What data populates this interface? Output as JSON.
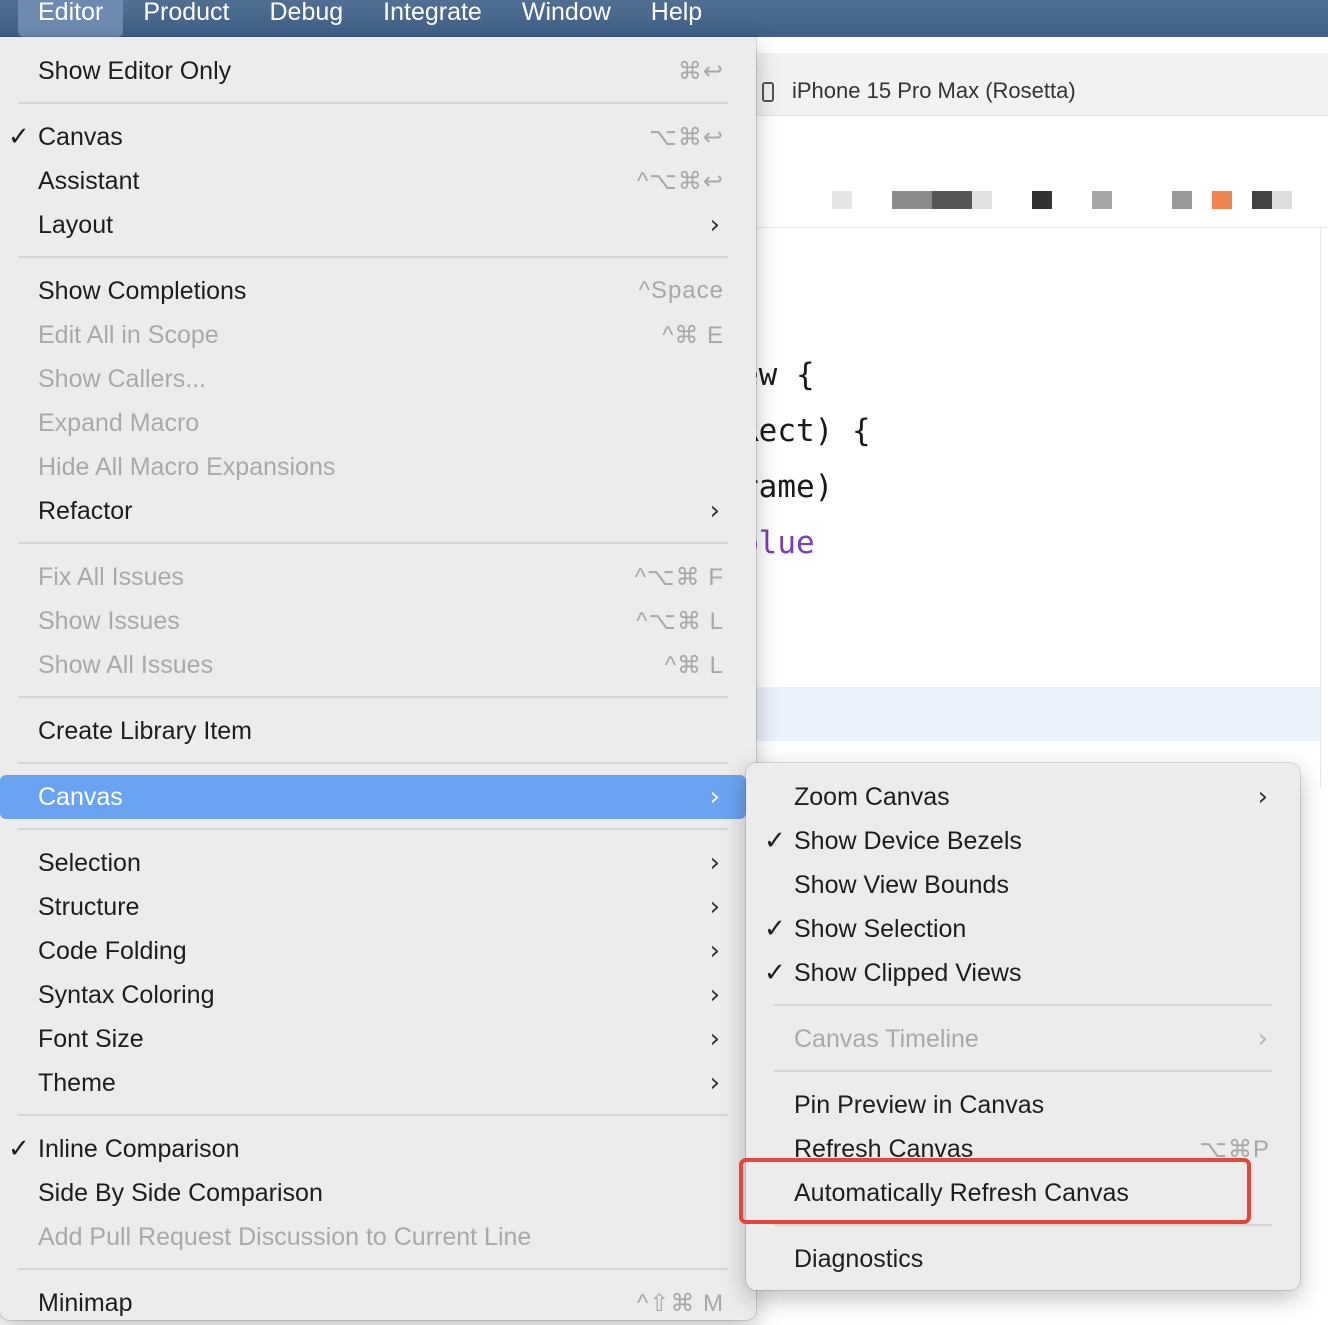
{
  "menubar": {
    "items": [
      "Editor",
      "Product",
      "Debug",
      "Integrate",
      "Window",
      "Help"
    ],
    "active": "Editor"
  },
  "editor": {
    "device": "iPhone 15 Pro Max (Rosetta)",
    "code_lines": [
      "ew {",
      "Rect) {",
      "rame)",
      "blue"
    ]
  },
  "editor_menu": {
    "items": [
      {
        "label": "Show Editor Only",
        "shortcut": "⌘↩",
        "enabled": true
      },
      {
        "label": "Canvas",
        "shortcut": "⌥⌘↩",
        "checked": true,
        "enabled": true
      },
      {
        "label": "Assistant",
        "shortcut": "^⌥⌘↩",
        "enabled": true
      },
      {
        "label": "Layout",
        "submenu": true,
        "enabled": true
      },
      {
        "label": "Show Completions",
        "shortcut": "^Space",
        "enabled": true
      },
      {
        "label": "Edit All in Scope",
        "shortcut": "^⌘ E",
        "enabled": false
      },
      {
        "label": "Show Callers...",
        "enabled": false
      },
      {
        "label": "Expand Macro",
        "enabled": false
      },
      {
        "label": "Hide All Macro Expansions",
        "enabled": false
      },
      {
        "label": "Refactor",
        "submenu": true,
        "enabled": true
      },
      {
        "label": "Fix All Issues",
        "shortcut": "^⌥⌘ F",
        "enabled": false
      },
      {
        "label": "Show Issues",
        "shortcut": "^⌥⌘ L",
        "enabled": false
      },
      {
        "label": "Show All Issues",
        "shortcut": "^⌘ L",
        "enabled": false
      },
      {
        "label": "Create Library Item",
        "enabled": true
      },
      {
        "label": "Canvas",
        "submenu": true,
        "selected": true,
        "enabled": true
      },
      {
        "label": "Selection",
        "submenu": true,
        "enabled": true
      },
      {
        "label": "Structure",
        "submenu": true,
        "enabled": true
      },
      {
        "label": "Code Folding",
        "submenu": true,
        "enabled": true
      },
      {
        "label": "Syntax Coloring",
        "submenu": true,
        "enabled": true
      },
      {
        "label": "Font Size",
        "submenu": true,
        "enabled": true
      },
      {
        "label": "Theme",
        "submenu": true,
        "enabled": true
      },
      {
        "label": "Inline Comparison",
        "checked": true,
        "enabled": true
      },
      {
        "label": "Side By Side Comparison",
        "enabled": true
      },
      {
        "label": "Add Pull Request Discussion to Current Line",
        "enabled": false
      },
      {
        "label": "Minimap",
        "shortcut": "^⇧⌘ M",
        "enabled": true
      }
    ]
  },
  "canvas_submenu": {
    "items": [
      {
        "label": "Zoom Canvas",
        "submenu": true,
        "enabled": true
      },
      {
        "label": "Show Device Bezels",
        "checked": true,
        "enabled": true
      },
      {
        "label": "Show View Bounds",
        "enabled": true
      },
      {
        "label": "Show Selection",
        "checked": true,
        "enabled": true
      },
      {
        "label": "Show Clipped Views",
        "checked": true,
        "enabled": true
      },
      {
        "label": "Canvas Timeline",
        "submenu": true,
        "enabled": false
      },
      {
        "label": "Pin Preview in Canvas",
        "enabled": true
      },
      {
        "label": "Refresh Canvas",
        "shortcut": "⌥⌘P",
        "enabled": true
      },
      {
        "label": "Automatically Refresh Canvas",
        "enabled": true,
        "annotated": true
      },
      {
        "label": "Diagnostics",
        "enabled": true
      }
    ]
  },
  "colors": {
    "selection": "#6aa3f1",
    "annotation_box": "#e8443a",
    "menubar": "#47678d"
  },
  "glyphs": {
    "check": "✓",
    "chevron": "›"
  }
}
